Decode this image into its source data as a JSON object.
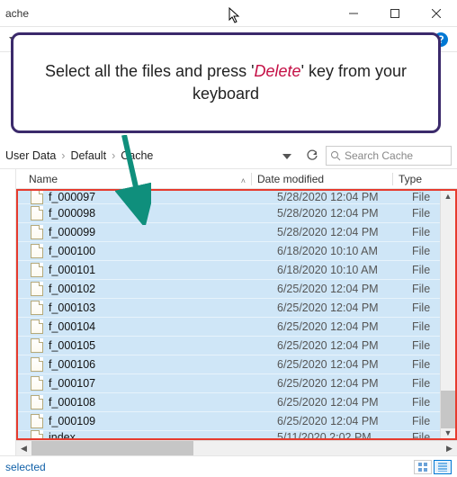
{
  "titlebar": {
    "title_fragment": "ache"
  },
  "helpbar": {
    "tooltip": "?"
  },
  "callout": {
    "prefix": "Select all the files and press '",
    "emph": "Delete",
    "suffix": "' key from your keyboard"
  },
  "breadcrumb": {
    "items": [
      "User Data",
      "Default",
      "Cache"
    ],
    "search_placeholder": "Search Cache"
  },
  "columns": {
    "name": "Name",
    "date": "Date modified",
    "type": "Type"
  },
  "files": [
    {
      "name": "f_000097",
      "date": "5/28/2020 12:04 PM",
      "type": "File"
    },
    {
      "name": "f_000098",
      "date": "5/28/2020 12:04 PM",
      "type": "File"
    },
    {
      "name": "f_000099",
      "date": "5/28/2020 12:04 PM",
      "type": "File"
    },
    {
      "name": "f_000100",
      "date": "6/18/2020 10:10 AM",
      "type": "File"
    },
    {
      "name": "f_000101",
      "date": "6/18/2020 10:10 AM",
      "type": "File"
    },
    {
      "name": "f_000102",
      "date": "6/25/2020 12:04 PM",
      "type": "File"
    },
    {
      "name": "f_000103",
      "date": "6/25/2020 12:04 PM",
      "type": "File"
    },
    {
      "name": "f_000104",
      "date": "6/25/2020 12:04 PM",
      "type": "File"
    },
    {
      "name": "f_000105",
      "date": "6/25/2020 12:04 PM",
      "type": "File"
    },
    {
      "name": "f_000106",
      "date": "6/25/2020 12:04 PM",
      "type": "File"
    },
    {
      "name": "f_000107",
      "date": "6/25/2020 12:04 PM",
      "type": "File"
    },
    {
      "name": "f_000108",
      "date": "6/25/2020 12:04 PM",
      "type": "File"
    },
    {
      "name": "f_000109",
      "date": "6/25/2020 12:04 PM",
      "type": "File"
    },
    {
      "name": "index",
      "date": "5/11/2020 2:02 PM",
      "type": "File"
    }
  ],
  "status": {
    "text": "selected"
  }
}
